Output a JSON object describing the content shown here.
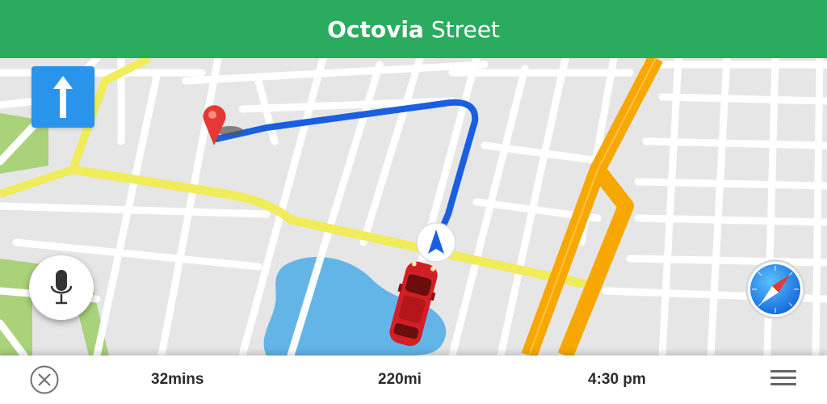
{
  "header": {
    "street_name": "Octovia",
    "street_type": "Street"
  },
  "trip": {
    "duration": "32mins",
    "distance": "220mi",
    "arrival_time": "4:30 pm"
  },
  "icons": {
    "close": "close-circle-icon",
    "menu": "hamburger-menu-icon",
    "direction": "arrow-up-icon",
    "mic": "microphone-icon",
    "compass": "compass-icon",
    "destination": "location-pin-icon",
    "car": "car-icon",
    "position": "navigation-arrow-icon"
  },
  "colors": {
    "header": "#2bab5e",
    "route": "#1a5fe0",
    "direction_button": "#2a93ea",
    "highway": "#f6a800",
    "secondary_road": "#f0ec5a",
    "water": "#63b5e8",
    "park": "#a9d27a",
    "pin": "#e53935",
    "car": "#d21f25"
  }
}
